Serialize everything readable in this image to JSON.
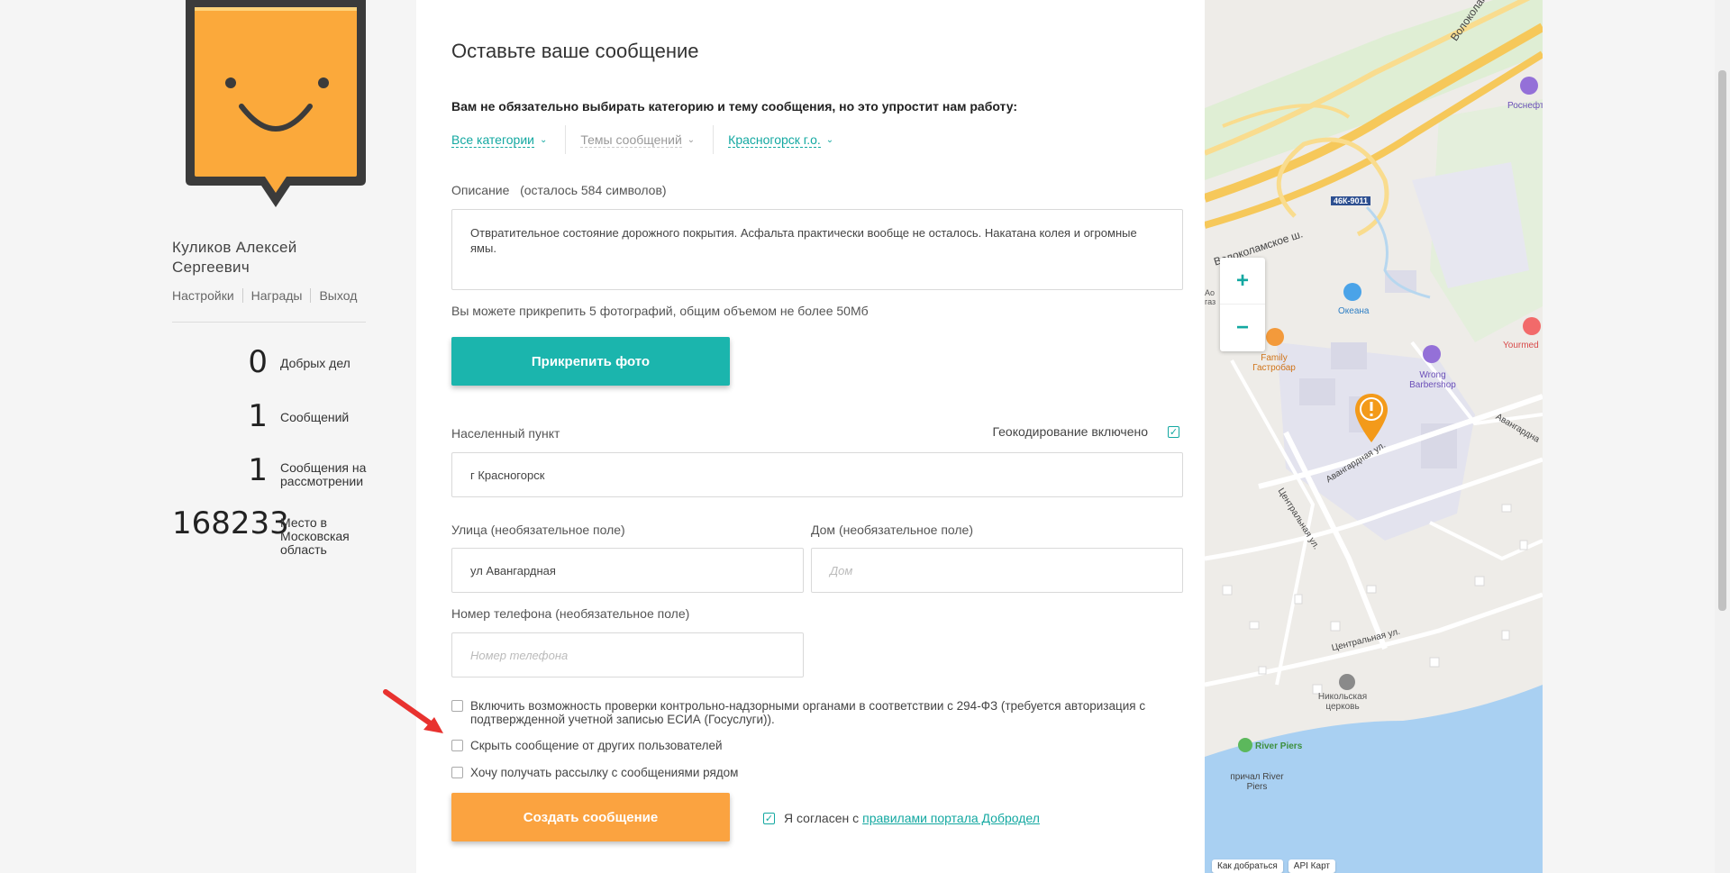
{
  "user": {
    "name": "Куликов Алексей Сергеевич",
    "links": [
      "Настройки",
      "Награды",
      "Выход"
    ]
  },
  "stats": [
    {
      "value": "0",
      "label": "Добрых дел"
    },
    {
      "value": "1",
      "label": "Сообщений"
    },
    {
      "value": "1",
      "label": "Сообщения на рассмотрении"
    },
    {
      "value": "168233",
      "label": "Место в Московская область"
    }
  ],
  "form": {
    "title": "Оставьте ваше сообщение",
    "category_hint": "Вам не обязательно выбирать категорию и тему сообщения, но это упростит нам работу:",
    "filters": [
      "Все категории",
      "Темы сообщений",
      "Красногорск г.о."
    ],
    "description_label": "Описание",
    "description_counter": "(осталось 584 символов)",
    "description_value": "Отвратительное состояние дорожного покрытия. Асфальта практически вообще не осталось. Накатана колея и огромные ямы.",
    "photo_hint": "Вы можете прикрепить 5 фотографий, общим объемом не более 50Мб",
    "attach_button": "Прикрепить фото",
    "locality_label": "Населенный пункт",
    "geocoding_label": "Геокодирование включено",
    "locality_value": "г Красногорск",
    "street_label": "Улица (необязательное поле)",
    "street_value": "ул Авангардная",
    "house_label": "Дом (необязательное поле)",
    "house_placeholder": "Дом",
    "phone_label": "Номер телефона (необязательное поле)",
    "phone_placeholder": "Номер телефона",
    "option_inspection": "Включить возможность проверки контрольно-надзорными органами в соответствии с 294-ФЗ (требуется авторизация с подтвержденной учетной записью ЕСИА (Госуслуги)).",
    "option_hide": "Скрыть сообщение от других пользователей",
    "option_newsletter": "Хочу получать рассылку с сообщениями рядом",
    "create_button": "Создать сообщение",
    "agree_text": "Я согласен с",
    "agree_link": "правилами портала Добродел"
  },
  "map": {
    "labels": {
      "volokolamskoe_top": "Волоколамское ш.",
      "volokolamskoe_mid": "Волоколамское ш.",
      "road_code": "46К-9011",
      "rosneft": "Роснефть",
      "okeana": "Океана",
      "family": "Family Гастробар",
      "wrong": "Wrong Barbershop",
      "yourmed": "Yourmed",
      "avangardnaya": "Авангардная ул.",
      "avangardnaya_right": "Авангардна",
      "tsentralnaya": "Центральная ул.",
      "tsentralnaya2": "Центральная ул.",
      "church": "Никольская церковь",
      "river_piers": "River Piers",
      "pier": "причал River Piers",
      "bus": "Ао газ"
    },
    "zoom_in": "+",
    "zoom_out": "−",
    "bottom": [
      "Как добраться",
      "API Карт"
    ]
  },
  "colors": {
    "teal": "#1bb5ad",
    "orange": "#fba340",
    "marker": "#f39a1a"
  }
}
